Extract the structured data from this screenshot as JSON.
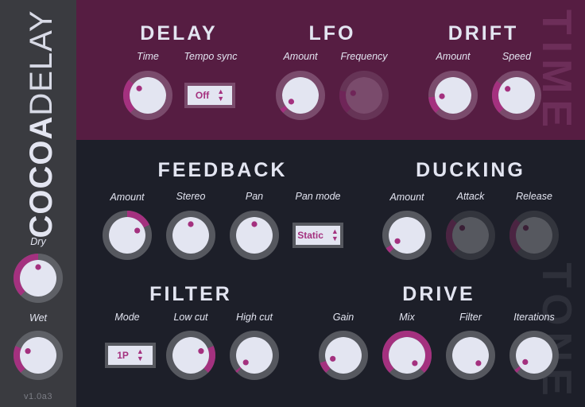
{
  "app": {
    "title_bold": "COCOA",
    "title_light": "DELAY",
    "version": "v1.0a3"
  },
  "colors": {
    "accent": "#a4317f",
    "sidebar_bg": "#3a3b40",
    "time_bg": "#561d42",
    "tone_bg": "#1d1f29",
    "knob_face": "#e3e5f1"
  },
  "sidebar": {
    "knobs": [
      {
        "id": "dry",
        "label": "Dry",
        "value": 0.5,
        "mode": "unipolar"
      },
      {
        "id": "wet",
        "label": "Wet",
        "value": 0.25,
        "mode": "unipolar"
      }
    ]
  },
  "time_panel": {
    "watermark": "TIME",
    "sections": {
      "delay": {
        "title": "DELAY",
        "time": {
          "label": "Time",
          "value": 0.31,
          "mode": "unipolar"
        },
        "tempo_sync": {
          "label": "Tempo sync",
          "selected": "Off"
        }
      },
      "lfo": {
        "title": "LFO",
        "amount": {
          "label": "Amount",
          "value": 0.04,
          "mode": "unipolar"
        },
        "frequency": {
          "label": "Frequency",
          "value": 0.21,
          "mode": "unipolar",
          "disabled": true
        }
      },
      "drift": {
        "title": "DRIFT",
        "amount": {
          "label": "Amount",
          "value": 0.15,
          "mode": "unipolar"
        },
        "speed": {
          "label": "Speed",
          "value": 0.3,
          "mode": "unipolar"
        }
      }
    }
  },
  "tone_panel": {
    "watermark": "TONE",
    "sections": {
      "feedback": {
        "title": "FEEDBACK",
        "amount": {
          "label": "Amount",
          "value": 0.74,
          "mode": "bipolar"
        },
        "stereo": {
          "label": "Stereo",
          "value": 0.5,
          "mode": "bipolar"
        },
        "pan": {
          "label": "Pan",
          "value": 0.5,
          "mode": "bipolar"
        },
        "pan_mode": {
          "label": "Pan mode",
          "selected": "Static"
        }
      },
      "ducking": {
        "title": "DUCKING",
        "amount": {
          "label": "Amount",
          "value": 0.05,
          "mode": "unipolar"
        },
        "attack": {
          "label": "Attack",
          "value": 0.32,
          "mode": "unipolar",
          "disabled": true
        },
        "release": {
          "label": "Release",
          "value": 0.32,
          "mode": "unipolar",
          "disabled": true
        }
      },
      "filter": {
        "title": "FILTER",
        "mode": {
          "label": "Mode",
          "selected": "1P"
        },
        "low_cut": {
          "label": "Low cut",
          "value": 0.75,
          "mode": "reverse"
        },
        "high_cut": {
          "label": "High cut",
          "value": 0.02,
          "mode": "unipolar"
        }
      },
      "drive": {
        "title": "DRIVE",
        "gain": {
          "label": "Gain",
          "value": 0.1,
          "mode": "unipolar"
        },
        "mix": {
          "label": "Mix",
          "value": 1.0,
          "mode": "unipolar"
        },
        "filter": {
          "label": "Filter",
          "value": 1.0,
          "mode": "reverse"
        },
        "iterations": {
          "label": "Iterations",
          "value": 0.03,
          "mode": "unipolar"
        }
      }
    }
  }
}
